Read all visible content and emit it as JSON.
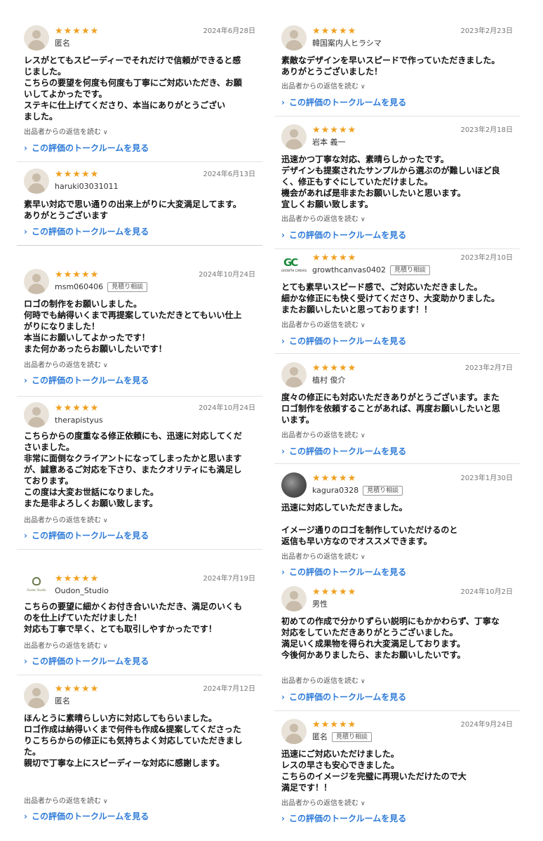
{
  "common": {
    "reply_label": "出品者からの返信を読む",
    "talk_label": "この評価のトークルームを見る",
    "stars": "★★★★★",
    "badge": "見積り相談"
  },
  "left": [
    {
      "date": "2024年6月28日",
      "user": "匿名",
      "badge": false,
      "text": "レスがとてもスピーディーでそれだけで信頼ができると感\nじました。\nこちらの要望を何度も何度も丁寧にご対応いただき、お願\nいしてよかったです。\nステキに仕上げてくださり、本当にありがとうござい\nました。"
    },
    {
      "date": "2024年6月13日",
      "user": "haruki03031011",
      "badge": false,
      "text": "素早い対応で思い通りの出来上がりに大変満足してます。\nありがとうございます"
    },
    {
      "date": "2024年10月24日",
      "user": "msm060406",
      "badge": true,
      "text": "ロゴの制作をお願いしました。\n何時でも納得いくまで再提案していただきとてもいい仕上\nがりになりました！\n本当にお願いしてよかったです！\nまた何かあったらお願いしたいです！"
    },
    {
      "date": "2024年10月24日",
      "user": "therapistyus",
      "badge": false,
      "text": "こちらからの度重なる修正依頼にも、迅速に対応してくだ\nさいました。\n非常に面倒なクライアントになってしまったかと思います\nが、誠意あるご対応を下さり、またクオリティにも満足し\nております。\nこの度は大変お世話になりました。\nまた是非よろしくお願い致します。"
    },
    {
      "date": "2024年7月19日",
      "user": "Oudon_Studio",
      "badge": false,
      "avatar_caption": "Oudon Studio",
      "text": "こちらの要望に細かくお付き合いいただき、満足のいくも\nのを仕上げていただけました！\n対応も丁寧で早く、とても取引しやすかったです！"
    },
    {
      "date": "2024年7月12日",
      "user": "匿名",
      "badge": false,
      "text": "ほんとうに素晴らしい方に対応してもらいました。\nロゴ作成は納得いくまで何件も作成&提案してくださっta\nりこちらからの修正にも気持ちよく対応していただきまし\nた。\n親切で丁寧な上にスピーディーな対応に感謝します。"
    }
  ],
  "right": [
    {
      "date": "2023年2月23日",
      "user": "韓国案内人ヒラシマ",
      "badge": false,
      "text": "素敵なデザインを早いスピードで作っていただきました。\nありがとうございました！"
    },
    {
      "date": "2023年2月18日",
      "user": "岩本 義一",
      "badge": false,
      "text": "迅速かつ丁寧な対応、素晴らしかったです。\nデザインも提案されたサンプルから選ぶのが難しいほど良\nく、修正もすぐにしていただけました。\n機会があれば是非またお願いしたいと思います。\n宜しくお願い致します。"
    },
    {
      "date": "2023年2月10日",
      "user": "growthcanvas0402",
      "badge": true,
      "avatar_text": "GC",
      "avatar_caption": "GROWTH CANVAS",
      "text": "とても素早いスピード感で、ご対応いただきました。\n細かな修正にも快く受けてくださり、大変助かりました。\nまたお願いしたいと思っております！！"
    },
    {
      "date": "2023年2月7日",
      "user": "植村 俊介",
      "badge": false,
      "text": "度々の修正にも対応いただきありがとうございます。また\nロゴ制作を依頼することがあれば、再度お願いしたいと思\nいます。"
    },
    {
      "date": "2023年1月30日",
      "user": "kagura0328",
      "badge": true,
      "text": "迅速に対応していただきました。\n\nイメージ通りのロゴを制作していただけるのと\n返信も早い方なのでオススメできます。"
    },
    {
      "date": "2024年10月2日",
      "user": "男性",
      "badge": false,
      "text": "初めての作成で分かりずらい説明にもかかわらず、丁寧な\n対応をしていただきありがとうございました。\n満足いく成果物を得られ大変満足しております。\n今後何かありましたら、またお願いしたいです。"
    },
    {
      "date": "2024年9月24日",
      "user": "匿名",
      "badge": true,
      "text": "迅速にご対応いただけました。\nレスの早さも安心できました。\nこちらのイメージを完璧に再現いただけたので大\n満足です！！"
    }
  ]
}
